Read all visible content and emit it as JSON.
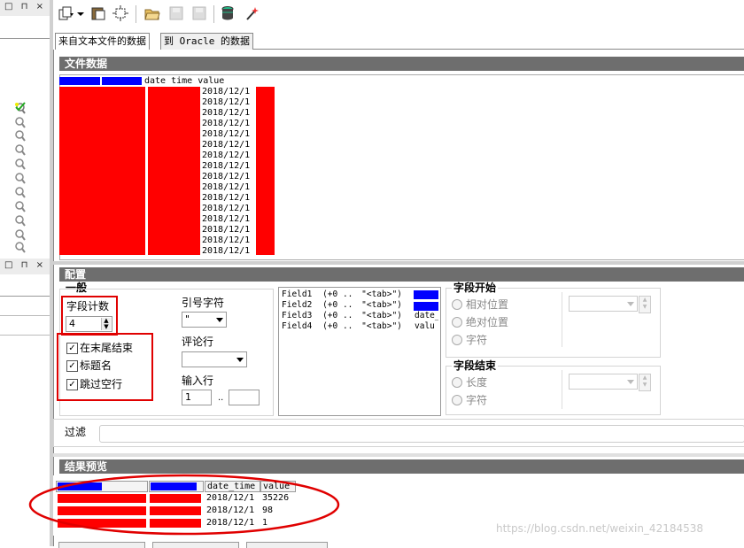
{
  "left_panel": {
    "top_header_buttons": "□ ⊓ ×",
    "mid_header_buttons": "□ ⊓ ×",
    "node_icons": [
      "check-magnifier-icon",
      "magnifier-icon",
      "magnifier-icon",
      "magnifier-icon",
      "magnifier-icon",
      "magnifier-icon",
      "magnifier-icon",
      "magnifier-icon",
      "magnifier-icon",
      "magnifier-icon",
      "magnifier-icon",
      "magnifier-icon"
    ]
  },
  "toolbar": {
    "icons": [
      "copy-dropdown-icon",
      "paste-icon",
      "new-step-icon",
      "open-folder-icon",
      "save-icon",
      "save-as-icon",
      "database-icon",
      "wand-icon"
    ]
  },
  "tabs": [
    "来自文本文件的数据",
    "到 Oracle 的数据"
  ],
  "file_data": {
    "title": "文件数据",
    "header": "date time value",
    "dates": [
      "2018/12/1",
      "2018/12/1",
      "2018/12/1",
      "2018/12/1",
      "2018/12/1",
      "2018/12/1",
      "2018/12/1",
      "2018/12/1",
      "2018/12/1",
      "2018/12/1",
      "2018/12/1",
      "2018/12/1",
      "2018/12/1",
      "2018/12/1",
      "2018/12/1",
      "2018/12/1"
    ]
  },
  "config": {
    "title": "配置",
    "general_title": "一般",
    "field_count_label": "字段计数",
    "field_count_value": "4",
    "end_at_eol_label": "在末尾结束",
    "header_name_label": "标题名",
    "skip_empty_label": "跳过空行",
    "quote_char_label": "引号字符",
    "quote_char_value": "\"",
    "comment_line_label": "评论行",
    "input_line_label": "输入行",
    "input_line_from": "1",
    "input_line_sep": "..",
    "fields": [
      {
        "name": "Field1",
        "range": "(+0 ..",
        "delim": "\"<tab>\")",
        "target": ""
      },
      {
        "name": "Field2",
        "range": "(+0 ..",
        "delim": "\"<tab>\")",
        "target": ""
      },
      {
        "name": "Field3",
        "range": "(+0 ..",
        "delim": "\"<tab>\")",
        "target": "date_"
      },
      {
        "name": "Field4",
        "range": "(+0 ..",
        "delim": "\"<tab>\")",
        "target": "valu"
      }
    ],
    "field_start_title": "字段开始",
    "field_start_options": [
      "相对位置",
      "绝对位置",
      "字符"
    ],
    "field_end_title": "字段结束",
    "field_end_options": [
      "长度",
      "字符"
    ],
    "filter_label": "过滤"
  },
  "preview": {
    "title": "结果预览",
    "columns": [
      "",
      "",
      "date_time",
      "value"
    ],
    "rows": [
      {
        "date": "2018/12/1",
        "value": "35226"
      },
      {
        "date": "2018/12/1",
        "value": "98"
      },
      {
        "date": "2018/12/1",
        "value": "1"
      }
    ]
  },
  "watermark": "https://blog.csdn.net/weixin_42184538"
}
